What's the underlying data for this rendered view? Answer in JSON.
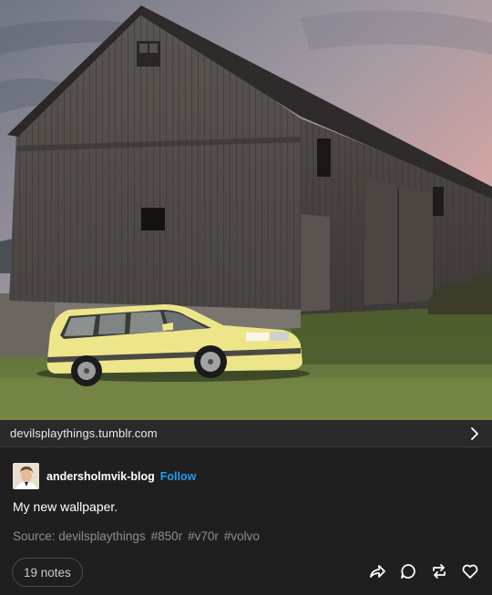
{
  "post": {
    "source_link": "devilsplaythings.tumblr.com",
    "author": "andersholmvik-blog",
    "follow_label": "Follow",
    "caption": "My new wallpaper.",
    "source_label": "Source: devilsplaythings",
    "tags": [
      "#850r",
      "#v70r",
      "#volvo"
    ],
    "notes": "19 notes"
  },
  "icons": {
    "chevron": "chevron-right-icon",
    "share": "share-icon",
    "reply": "reply-icon",
    "reblog": "reblog-icon",
    "like": "heart-icon"
  },
  "colors": {
    "background": "#1f1f20",
    "link_bar": "#2a2a2b",
    "follow": "#1e9df1",
    "muted_text": "#8e8e93",
    "car": "#ede58a"
  }
}
